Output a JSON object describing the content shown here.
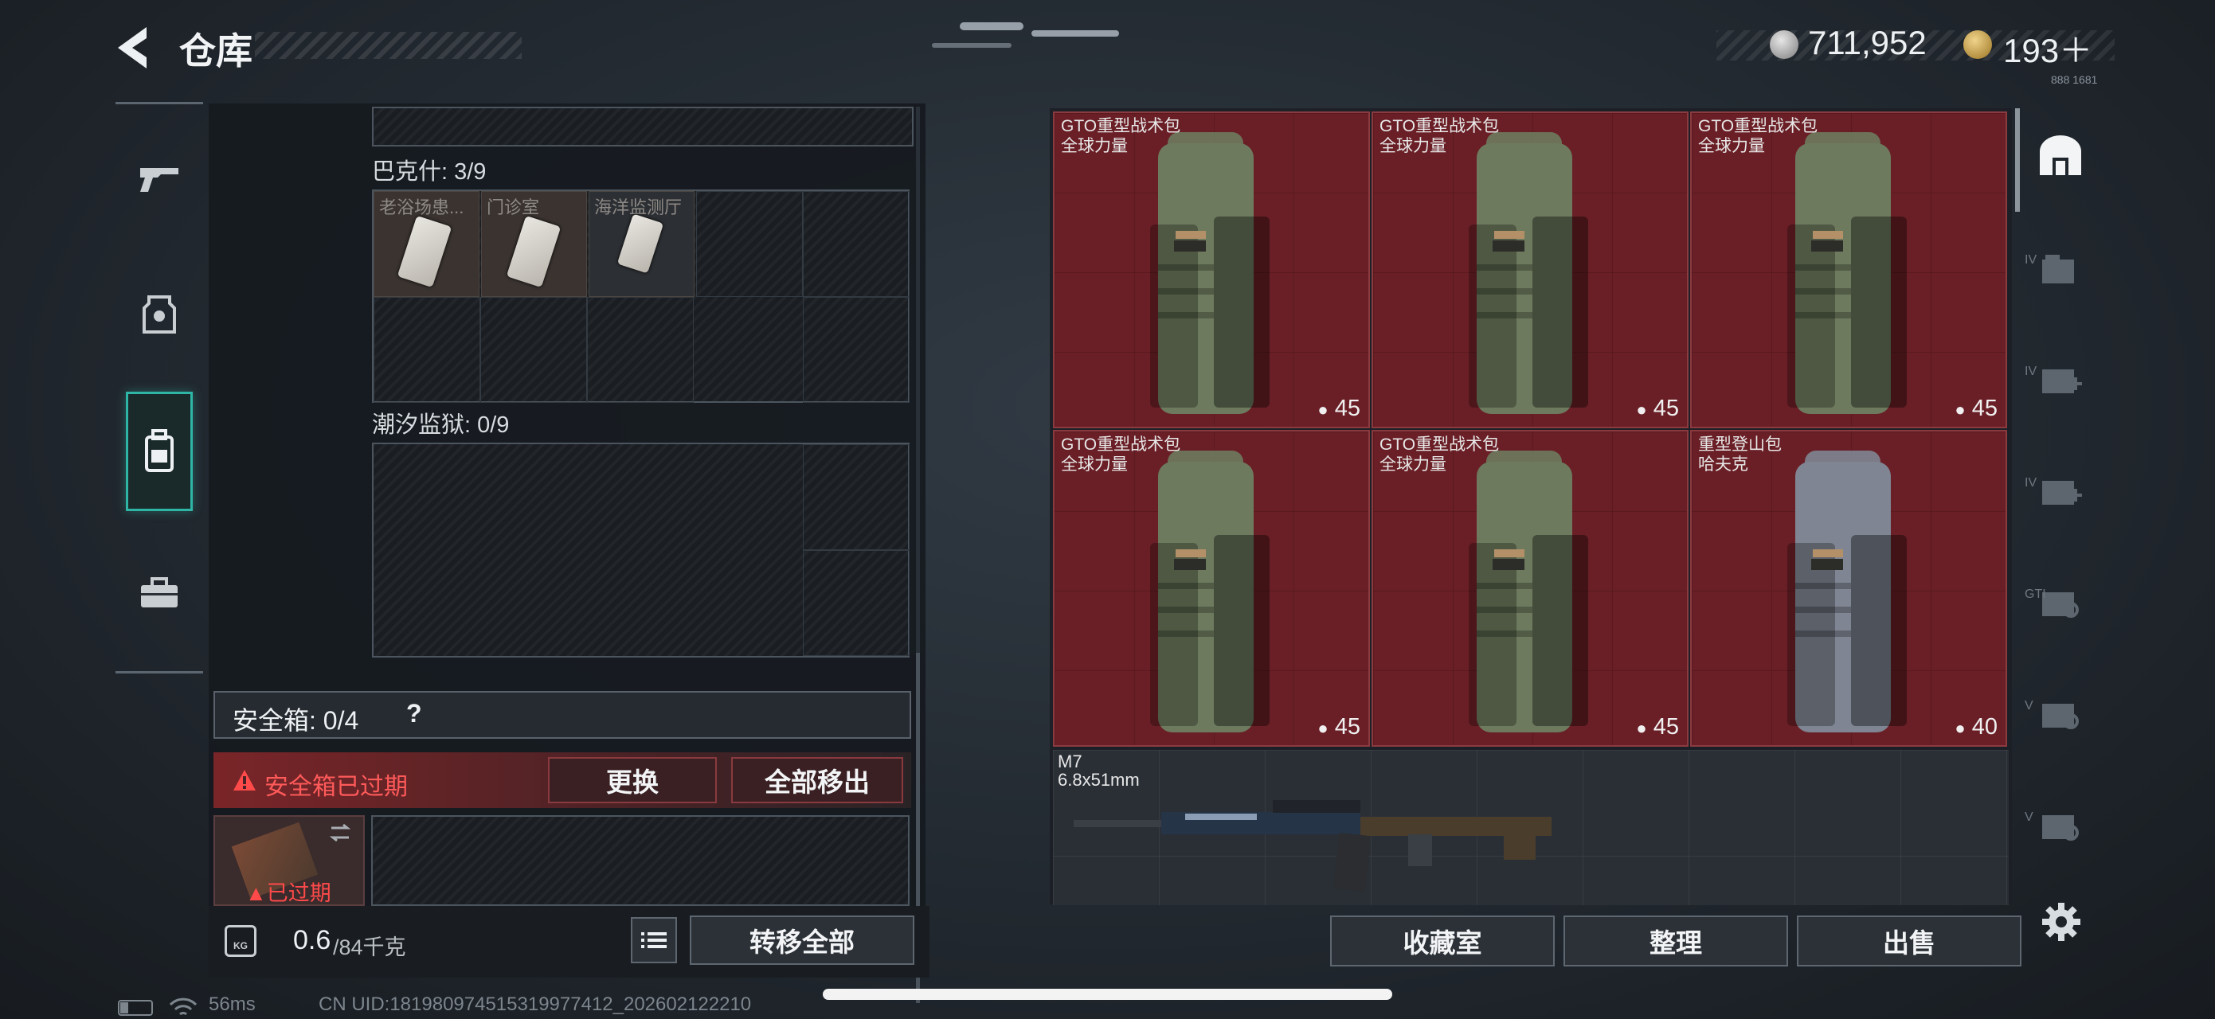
{
  "header": {
    "title": "仓库",
    "currency_silver": "711,952",
    "currency_gold": "193＋",
    "tiny_code": "888 1681"
  },
  "nav": {
    "items": [
      "weapons",
      "helmet",
      "backpack",
      "toolbox"
    ],
    "active_index": 2
  },
  "stash": {
    "section1_title": "巴克什: 3/9",
    "section1_items": [
      {
        "label": "老浴场患..."
      },
      {
        "label": "门诊室"
      },
      {
        "label": "海洋监测厅"
      }
    ],
    "section2_title": "潮汐监狱: 0/9",
    "safe_box_label": "安全箱:  0/4",
    "help_mark": "?",
    "expired_warning": "安全箱已过期",
    "replace_button": "更换",
    "move_all_out_button": "全部移出",
    "expired_badge": "已过期",
    "weight": "0.6",
    "weight_max": "/84千克",
    "weight_icon_label": "KG",
    "transfer_all_button": "转移全部"
  },
  "inventory": {
    "items": [
      {
        "name": "GTO重型战术包",
        "brand": "全球力量",
        "count": "45",
        "color": "#6d7a5e"
      },
      {
        "name": "GTO重型战术包",
        "brand": "全球力量",
        "count": "45",
        "color": "#6d7a5e"
      },
      {
        "name": "GTO重型战术包",
        "brand": "全球力量",
        "count": "45",
        "color": "#6d7a5e"
      },
      {
        "name": "GTO重型战术包",
        "brand": "全球力量",
        "count": "45",
        "color": "#6d7a5e"
      },
      {
        "name": "GTO重型战术包",
        "brand": "全球力量",
        "count": "45",
        "color": "#6d7a5e"
      },
      {
        "name": "重型登山包",
        "brand": "哈夫克",
        "count": "40",
        "color": "#7f8592"
      }
    ],
    "gun": {
      "name": "M7",
      "caliber": "6.8x51mm"
    },
    "collection_button": "收藏室",
    "sort_button": "整理",
    "sell_button": "出售"
  },
  "side_tools": {
    "labels": [
      "IV",
      "IV",
      "IV",
      "GTI",
      "V",
      "V"
    ]
  },
  "status_bar": {
    "ping": "56ms",
    "uid": "CN UID:181980974515319977412_202602122210"
  }
}
